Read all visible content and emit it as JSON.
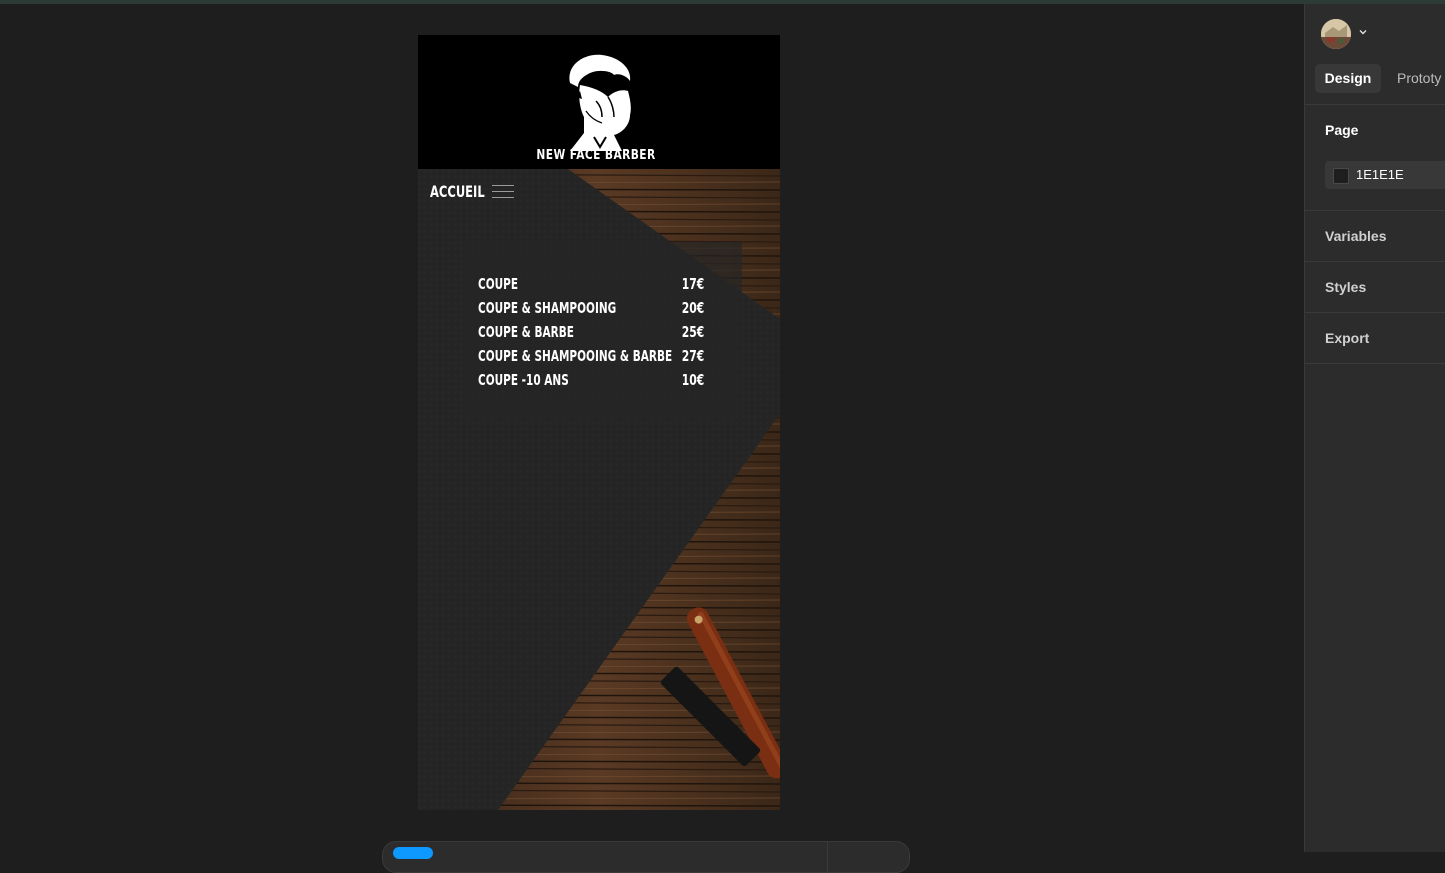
{
  "frame": {
    "brand_name": "NEW FACE BARBER",
    "nav_label": "ACCUEIL",
    "prices": [
      {
        "name": "COUPE",
        "price": "17€"
      },
      {
        "name": "COUPE & SHAMPOOING",
        "price": "20€"
      },
      {
        "name": "COUPE & BARBE",
        "price": "25€"
      },
      {
        "name": "COUPE & SHAMPOOING & BARBE",
        "price": "27€"
      },
      {
        "name": "COUPE -10 ANS",
        "price": "10€"
      }
    ]
  },
  "panel": {
    "tabs": {
      "design": "Design",
      "prototype": "Prototy"
    },
    "page": {
      "title": "Page",
      "background_color": "1E1E1E"
    },
    "sections": {
      "variables": "Variables",
      "styles": "Styles",
      "export": "Export"
    }
  },
  "colors": {
    "canvas_bg": "#1e1e1e",
    "panel_bg": "#2c2c2c",
    "accent": "#0d99ff",
    "frame_header": "#000000"
  },
  "icons": {
    "avatar": "user-avatar",
    "chevron": "chevron-down-icon",
    "menu": "hamburger-menu-icon",
    "logo": "bearded-man-logo"
  }
}
